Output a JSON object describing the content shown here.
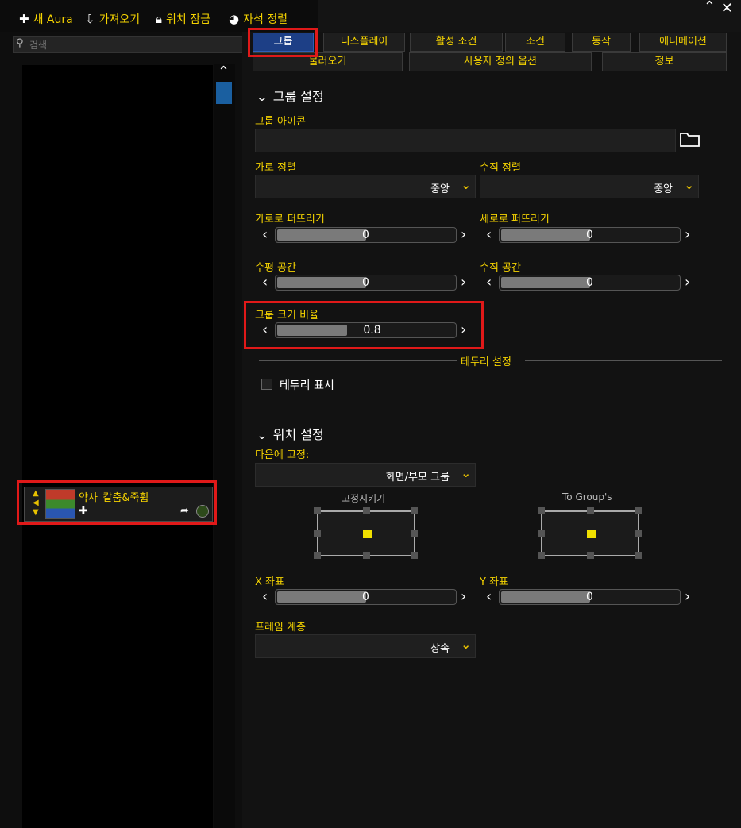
{
  "toolbar": {
    "new_aura": "새 Aura",
    "import": "가져오기",
    "lock_position": "위치 잠금",
    "magnetic_align": "자석 정렬"
  },
  "search": {
    "placeholder": "검색"
  },
  "aura": {
    "name": "약사_칼춤&죽휩",
    "icon_colors": [
      "#c03a2a",
      "#3c8a2c",
      "#2a56b0"
    ]
  },
  "tabs": {
    "row1": [
      "그룹",
      "디스플레이",
      "활성 조건",
      "조건",
      "동작",
      "애니메이션"
    ],
    "row2": [
      "불러오기",
      "사용자 정의 옵션",
      "정보"
    ],
    "active": "그룹"
  },
  "group_settings": {
    "title": "그룹 설정",
    "group_icon_label": "그룹 아이콘",
    "h_align_label": "가로 정렬",
    "h_align_value": "중앙",
    "v_align_label": "수직 정렬",
    "v_align_value": "중앙",
    "h_spread_label": "가로로 퍼뜨리기",
    "h_spread_value": "0",
    "v_spread_label": "세로로 퍼뜨리기",
    "v_spread_value": "0",
    "h_space_label": "수평 공간",
    "h_space_value": "0",
    "v_space_label": "수직 공간",
    "v_space_value": "0",
    "scale_label": "그룹 크기 비율",
    "scale_value": "0.8"
  },
  "border_settings": {
    "title": "테두리 설정",
    "show_border_label": "테두리 표시"
  },
  "position_settings": {
    "title": "위치 설정",
    "anchor_to_label": "다음에 고정:",
    "anchor_to_value": "화면/부모 그룹",
    "anchor_point_label": "고정시키기",
    "to_group_label": "To Group's",
    "x_label": "X 좌표",
    "x_value": "0",
    "y_label": "Y 좌표",
    "y_value": "0",
    "frame_strata_label": "프레임 계층",
    "frame_strata_value": "상속"
  },
  "highlight_color": "#e01919",
  "accent_color": "#f5d300"
}
